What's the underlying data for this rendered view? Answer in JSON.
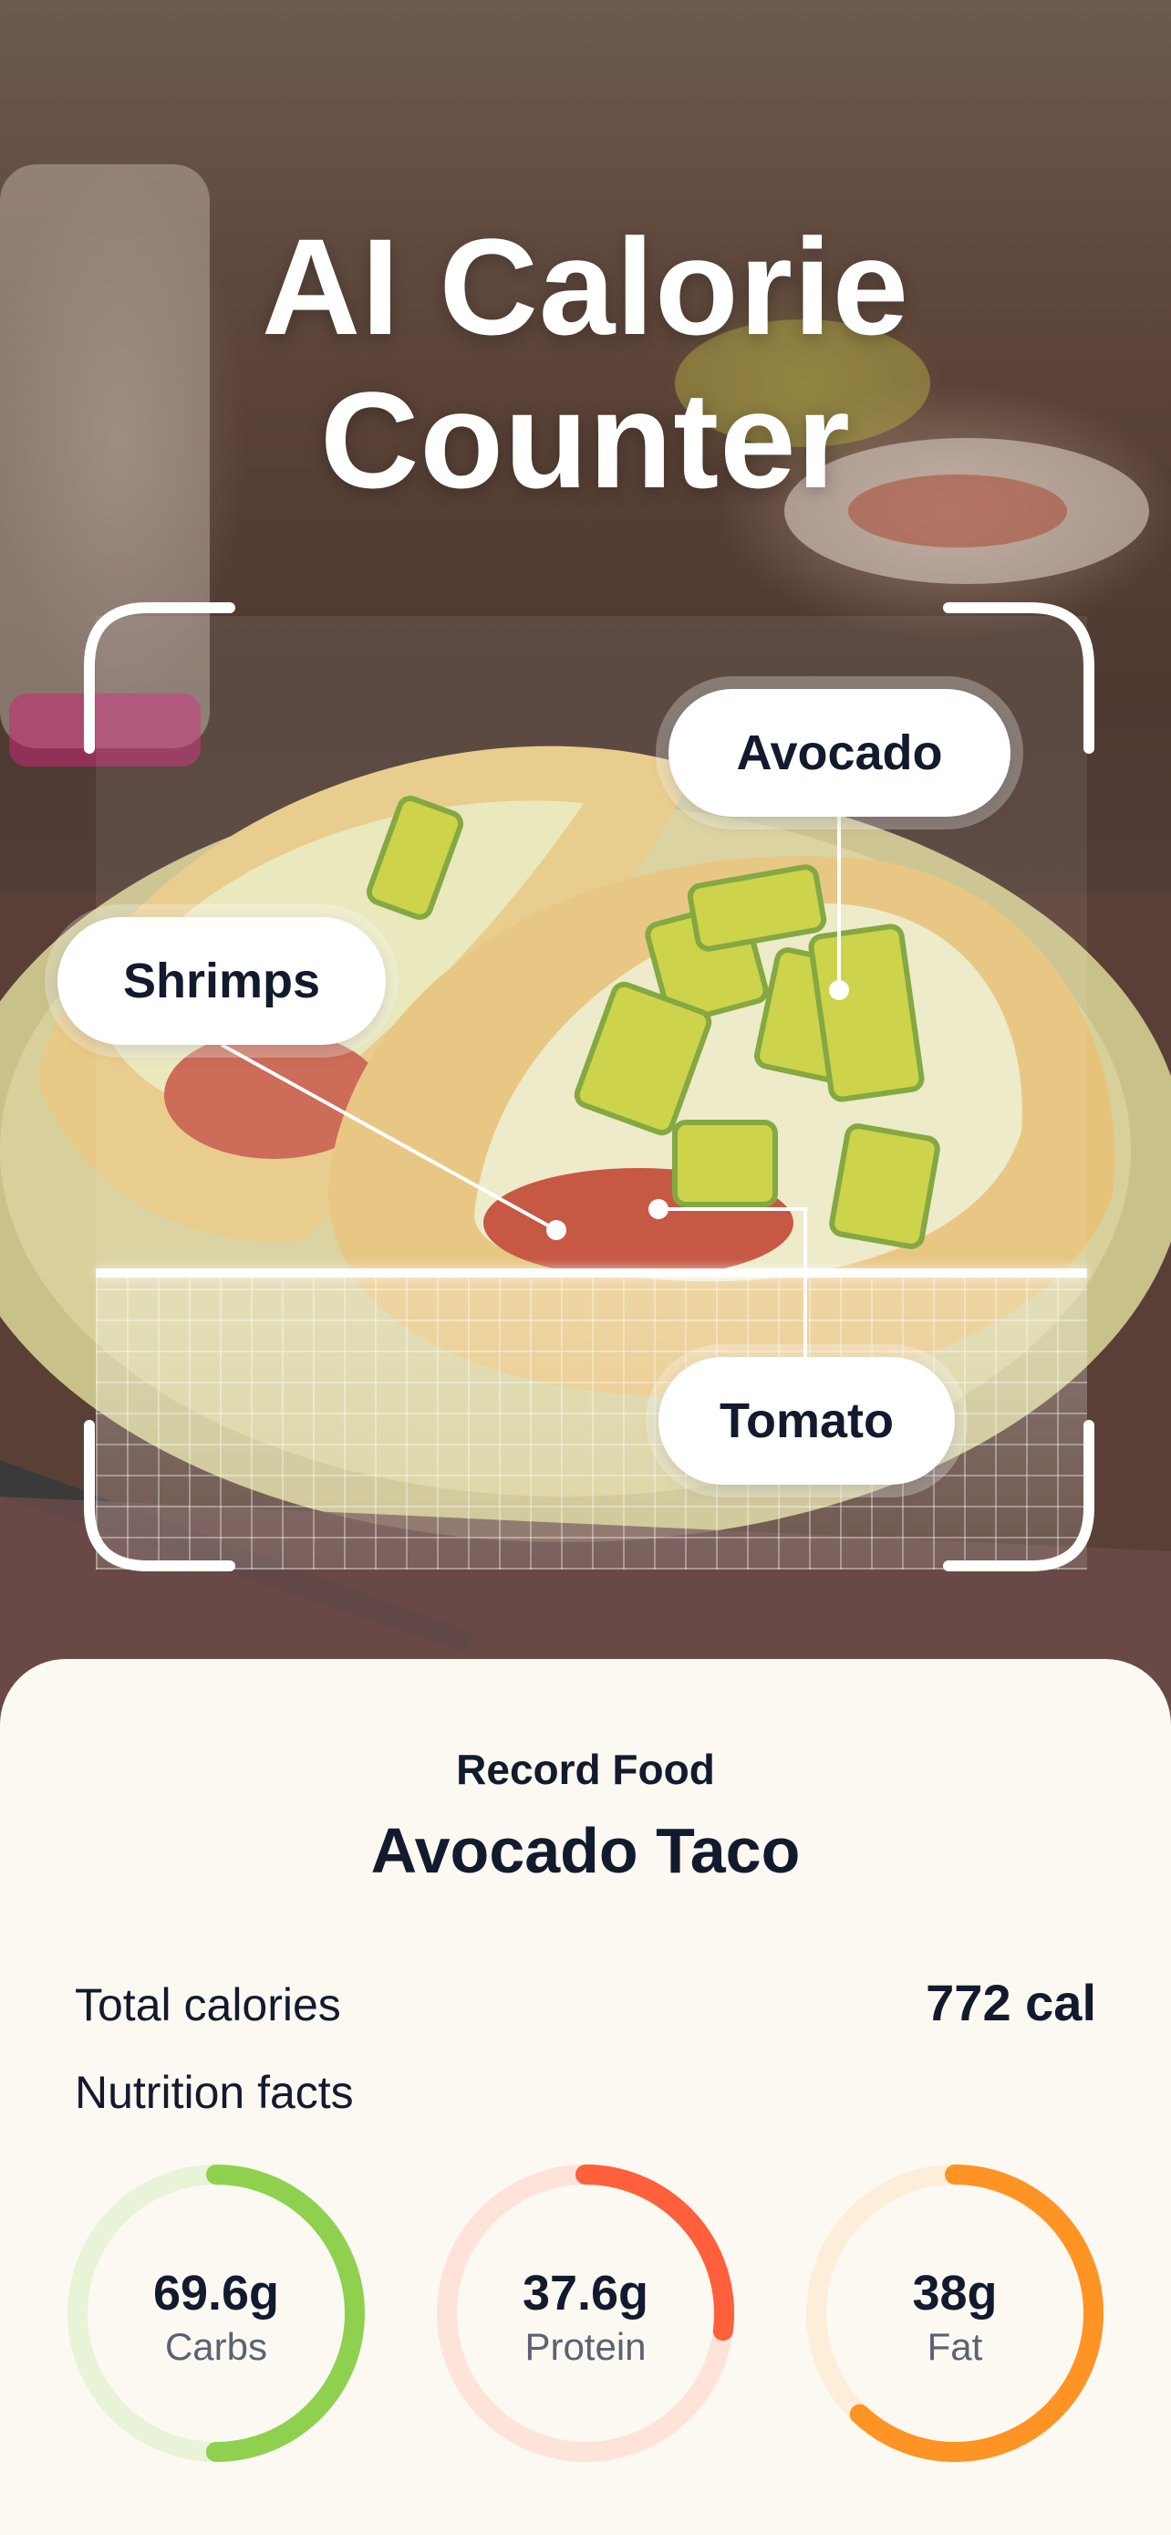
{
  "app": {
    "title_line1": "AI Calorie",
    "title_line2": "Counter"
  },
  "scan": {
    "labels": [
      {
        "name": "Avocado"
      },
      {
        "name": "Shrimps"
      },
      {
        "name": "Tomato"
      }
    ]
  },
  "record": {
    "kicker": "Record Food",
    "food_name": "Avocado Taco",
    "total_calories_label": "Total calories",
    "total_calories_value": "772 cal",
    "nutrition_label": "Nutrition facts"
  },
  "macros": [
    {
      "value": "69.6g",
      "label": "Carbs",
      "fraction": 0.5,
      "color": "#8fd14f",
      "track": "#e8f3d8"
    },
    {
      "value": "37.6g",
      "label": "Protein",
      "fraction": 0.27,
      "color": "#ff5f3a",
      "track": "#fde3da"
    },
    {
      "value": "38g",
      "label": "Fat",
      "fraction": 0.62,
      "color": "#ff9324",
      "track": "#fdeed9"
    }
  ]
}
